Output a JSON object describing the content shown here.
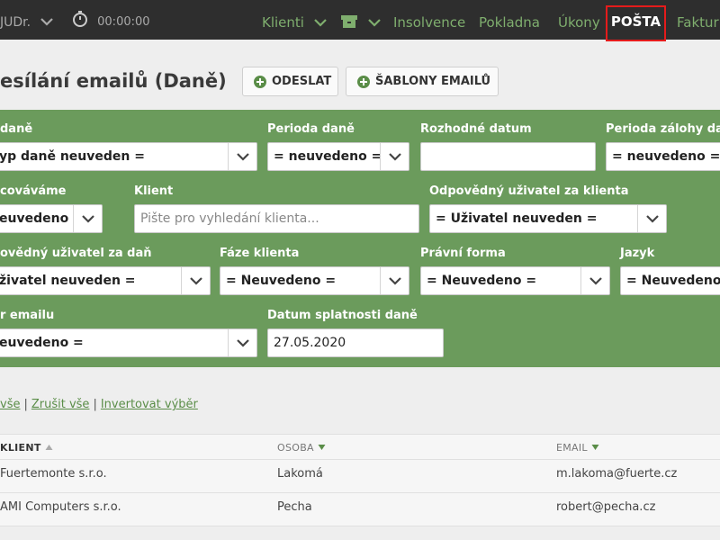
{
  "topnav": {
    "user": "JUDr.",
    "timer": "00:00:00",
    "items": [
      {
        "label": "Klienti"
      },
      {
        "label": "Insolvence"
      },
      {
        "label": "Pokladna"
      },
      {
        "label": "Úkony"
      },
      {
        "label": "POŠTA"
      },
      {
        "label": "Faktur"
      }
    ]
  },
  "page": {
    "title": "esílání emailů (Daně)",
    "buttons": {
      "send": "ODESLAT",
      "templates": "ŠABLONY EMAILŮ"
    }
  },
  "filters": {
    "row1": [
      {
        "label": "daně",
        "value": "yp daně neuveden ="
      },
      {
        "label": "Perioda daně",
        "value": "= neuvedeno ="
      },
      {
        "label": "Rozhodné datum",
        "value": ""
      },
      {
        "label": "Perioda zálohy dar",
        "value": "= neuvedeno ="
      }
    ],
    "row2": [
      {
        "label": "cováváme",
        "value": "euvedeno"
      },
      {
        "label": "Klient",
        "placeholder": "Pište pro vyhledání klienta..."
      },
      {
        "label": "Odpovědný uživatel za klienta",
        "value": "= Uživatel neuveden ="
      }
    ],
    "row3": [
      {
        "label": "ovědný uživatel za daň",
        "value": "živatel neuveden ="
      },
      {
        "label": "Fáze klienta",
        "value": "= Neuvedeno ="
      },
      {
        "label": "Právní forma",
        "value": "= Neuvedeno ="
      },
      {
        "label": "Jazyk",
        "value": "= Neuvedeno ="
      }
    ],
    "row4": [
      {
        "label": "r emailu",
        "value": "euvedeno ="
      },
      {
        "label": "Datum splatnosti daně",
        "value": "27.05.2020"
      }
    ]
  },
  "selection_links": {
    "select_all": "vše",
    "cancel_all": "Zrušit vše",
    "invert": "Invertovat výběr"
  },
  "table": {
    "headers": [
      "KLIENT",
      "OSOBA",
      "EMAIL"
    ],
    "rows": [
      {
        "client": "Fuertemonte s.r.o.",
        "person": "Lakomá",
        "email": "m.lakoma@fuerte.cz"
      },
      {
        "client": "AMI Computers s.r.o.",
        "person": "Pecha",
        "email": "robert@pecha.cz"
      }
    ]
  },
  "colors": {
    "nav_bg": "#2e2e2e",
    "nav_link": "#7fae6e",
    "active_border": "#e51b1b",
    "filter_panel": "#6b9b5c",
    "accent": "#5a8d48"
  }
}
